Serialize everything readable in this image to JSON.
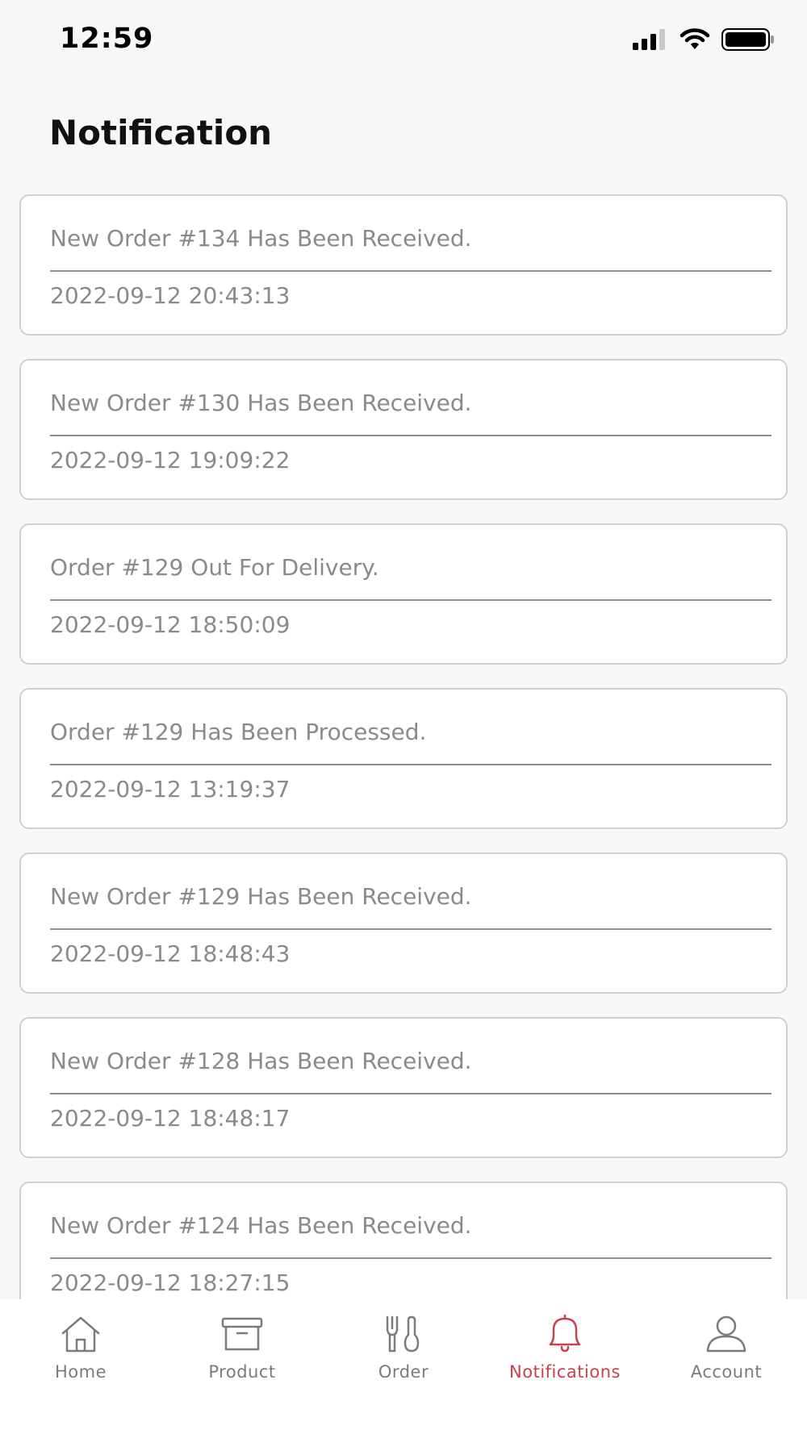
{
  "status_bar": {
    "time": "12:59"
  },
  "page": {
    "title": "Notification"
  },
  "notifications": [
    {
      "message": "New Order #134 Has Been Received.",
      "time": "2022-09-12 20:43:13"
    },
    {
      "message": "New Order #130 Has Been Received.",
      "time": "2022-09-12 19:09:22"
    },
    {
      "message": "Order #129 Out For Delivery.",
      "time": "2022-09-12 18:50:09"
    },
    {
      "message": "Order #129 Has Been Processed.",
      "time": "2022-09-12 13:19:37"
    },
    {
      "message": "New Order #129 Has Been Received.",
      "time": "2022-09-12 18:48:43"
    },
    {
      "message": "New Order #128 Has Been Received.",
      "time": "2022-09-12 18:48:17"
    },
    {
      "message": "New Order #124 Has Been Received.",
      "time": "2022-09-12 18:27:15"
    }
  ],
  "bottom_nav": {
    "items": [
      {
        "label": "Home",
        "icon": "home-icon",
        "active": false
      },
      {
        "label": "Product",
        "icon": "box-icon",
        "active": false
      },
      {
        "label": "Order",
        "icon": "fork-spoon-icon",
        "active": false
      },
      {
        "label": "Notifications",
        "icon": "bell-icon",
        "active": true
      },
      {
        "label": "Account",
        "icon": "user-icon",
        "active": false
      }
    ]
  },
  "colors": {
    "accent": "#c9414f",
    "inactive": "#7b7b7b",
    "text_muted": "#8a8a8a",
    "background": "#f7f7f7"
  }
}
